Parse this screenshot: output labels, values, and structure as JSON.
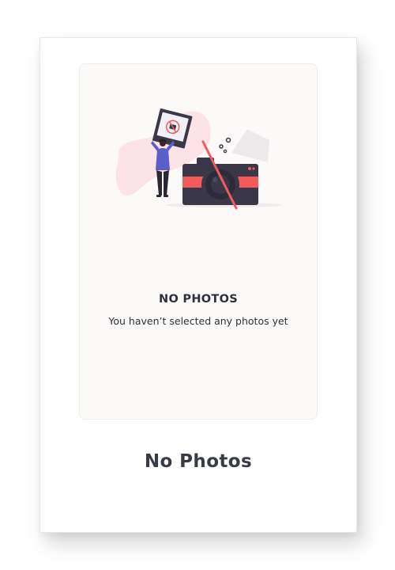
{
  "empty_state": {
    "title": "NO PHOTOS",
    "subtitle": "You haven’t selected any photos yet",
    "illustration_icon": "no-camera-illustration"
  },
  "footer": {
    "title": "No Photos"
  },
  "colors": {
    "text": "#2e2f3b",
    "accent_red": "#f45a5a",
    "blob_pink": "#fbe3e7",
    "camera_dark": "#3a3748",
    "figure_purple": "#5b5fc7",
    "panel_bg": "#fcfaf9"
  }
}
